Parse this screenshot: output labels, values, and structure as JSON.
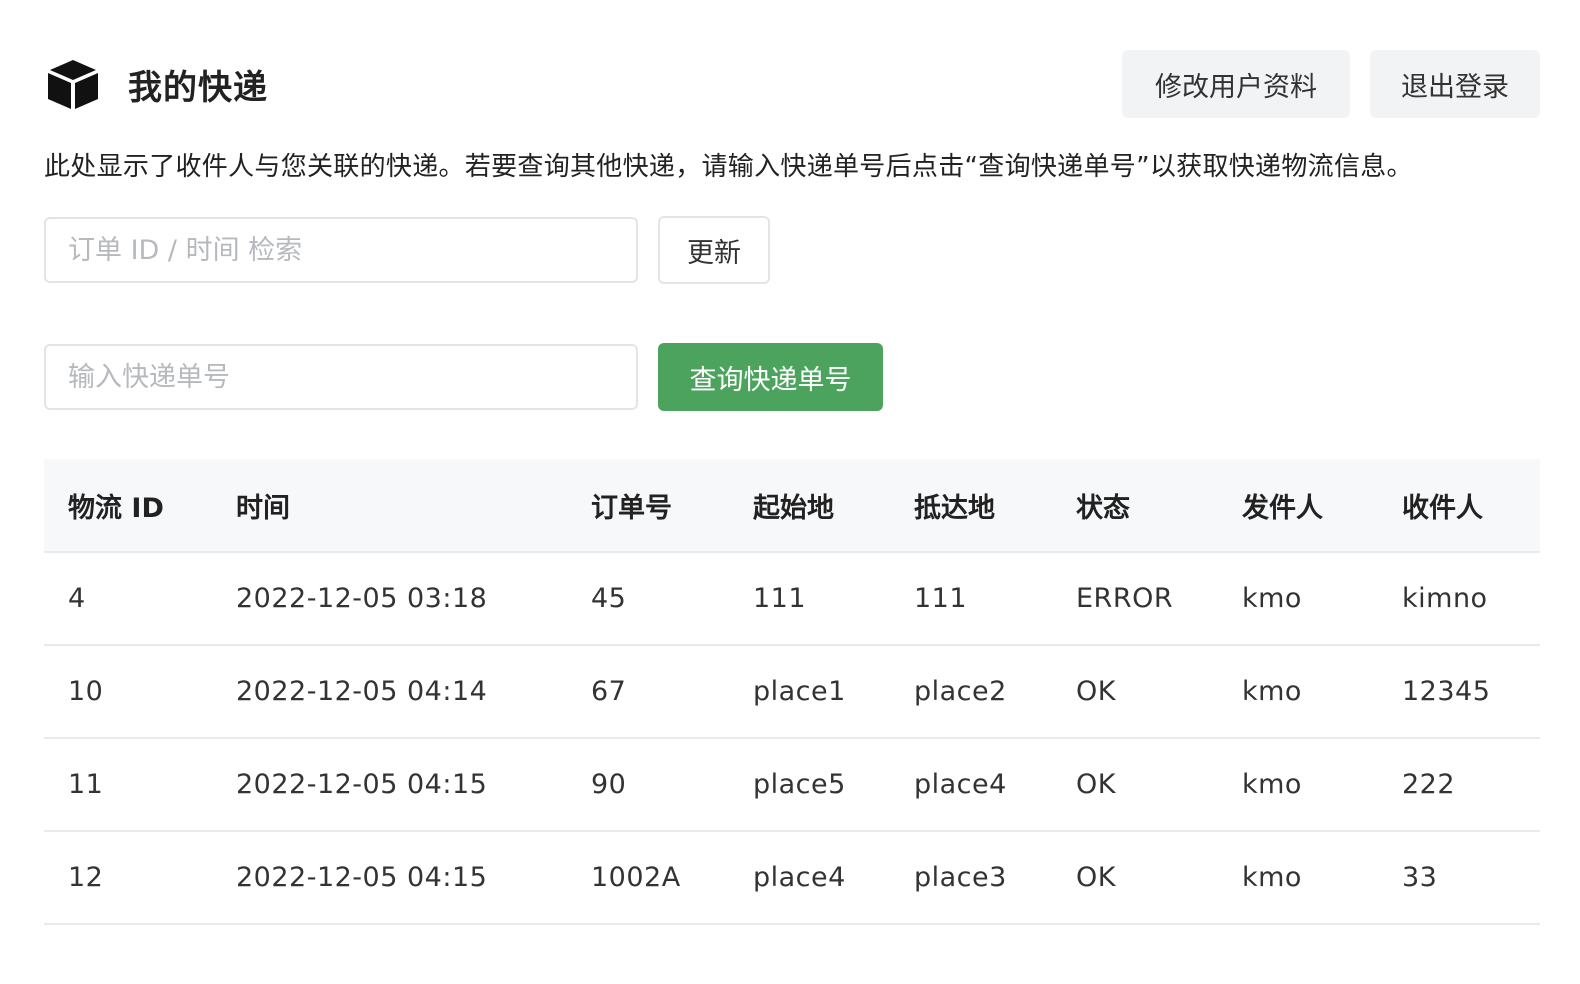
{
  "header": {
    "icon": "box-icon",
    "title": "我的快递",
    "edit_profile_label": "修改用户资料",
    "logout_label": "退出登录"
  },
  "description": "此处显示了收件人与您关联的快递。若要查询其他快递，请输入快递单号后点击“查询快递单号”以获取快递物流信息。",
  "search": {
    "placeholder": "订单 ID / 时间 检索",
    "value": "",
    "refresh_label": "更新"
  },
  "query": {
    "placeholder": "输入快递单号",
    "value": "",
    "button_label": "查询快递单号",
    "button_color": "#4ba35e"
  },
  "table": {
    "headers": [
      "物流 ID",
      "时间",
      "订单号",
      "起始地",
      "抵达地",
      "状态",
      "发件人",
      "收件人"
    ],
    "rows": [
      [
        "4",
        "2022-12-05 03:18",
        "45",
        "111",
        "111",
        "ERROR",
        "kmo",
        "kimno"
      ],
      [
        "10",
        "2022-12-05 04:14",
        "67",
        "place1",
        "place2",
        "OK",
        "kmo",
        "12345"
      ],
      [
        "11",
        "2022-12-05 04:15",
        "90",
        "place5",
        "place4",
        "OK",
        "kmo",
        "222"
      ],
      [
        "12",
        "2022-12-05 04:15",
        "1002A",
        "place4",
        "place3",
        "OK",
        "kmo",
        "33"
      ]
    ]
  }
}
